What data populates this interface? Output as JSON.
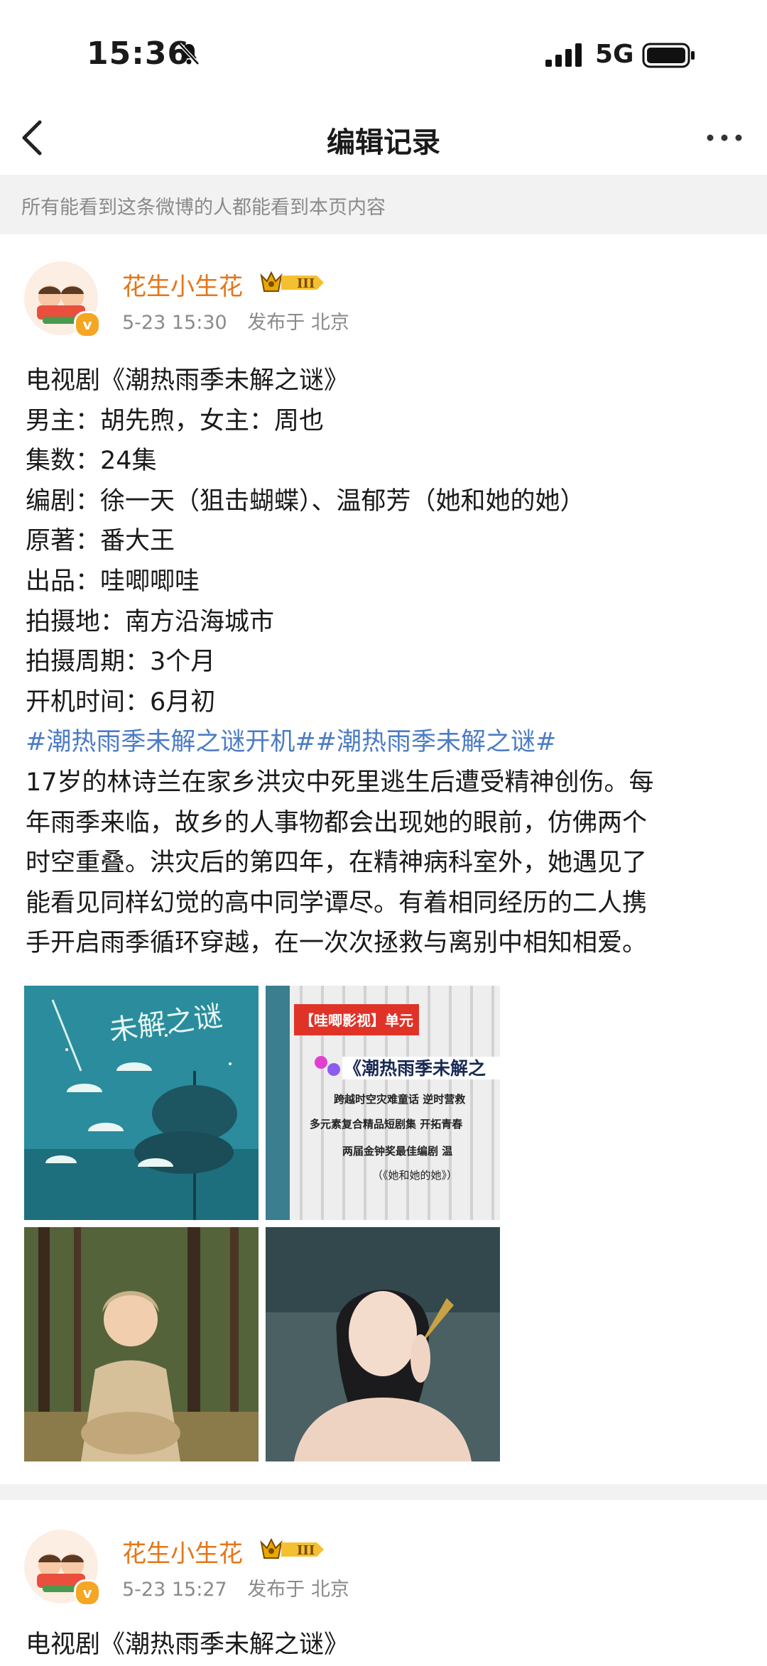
{
  "status": {
    "time": "15:36",
    "network": "5G"
  },
  "nav": {
    "title": "编辑记录"
  },
  "notice": "所有能看到这条微博的人都能看到本页内容",
  "post1": {
    "username": "花生小生花",
    "level": "III",
    "time": "5-23 15:30",
    "published": "发布于 北京",
    "lines": [
      "电视剧《潮热雨季未解之谜》",
      "男主：胡先煦，女主：周也",
      "集数：24集",
      "编剧：徐一天（狙击蝴蝶）、温郁芳（她和她的她）",
      "原著：番大王",
      "出品：哇唧唧哇",
      "拍摄地：南方沿海城市",
      "拍摄周期：3个月",
      "开机时间：6月初"
    ],
    "hashtags": "#潮热雨季未解之谜开机##潮热雨季未解之谜#",
    "description": [
      "17岁的林诗兰在家乡洪灾中死里逃生后遭受精神创伤。每",
      "年雨季来临，故乡的人事物都会出现她的眼前，仿佛两个",
      "时空重叠。洪灾后的第四年，在精神病科室外，她遇见了",
      "能看见同样幻觉的高中同学谭尽。有着相同经历的二人携",
      "手开启雨季循环穿越，在一次次拯救与离别中相知相爱。"
    ],
    "photo2": {
      "banner": "【哇唧影视】单元",
      "title": "《潮热雨季未解之",
      "line1": "跨越时空灾难童话  逆时营救",
      "line2": "多元素复合精品短剧集  开拓青春",
      "line3": "两届金钟奖最佳编剧  温",
      "line4": "（《她和她的她》）"
    },
    "photo1_title": "未解之谜"
  },
  "post2": {
    "username": "花生小生花",
    "level": "III",
    "time": "5-23 15:27",
    "published": "发布于 北京",
    "first_line": "电视剧《潮热雨季未解之谜》"
  }
}
